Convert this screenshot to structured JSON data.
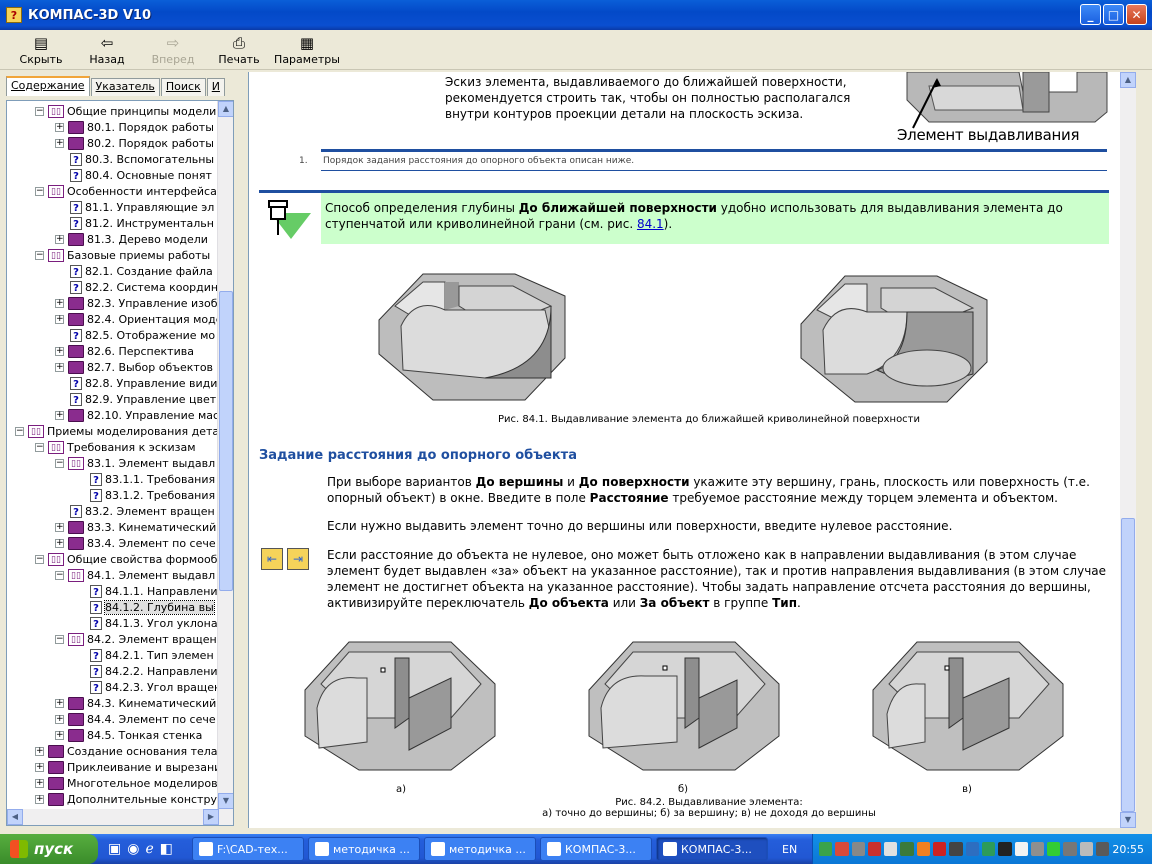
{
  "window": {
    "title": "КОМПАС-3D V10"
  },
  "toolbar": {
    "hide": "Скрыть",
    "back": "Назад",
    "forward": "Вперед",
    "print": "Печать",
    "options": "Параметры"
  },
  "tabs": [
    "Содержание",
    "Указатель",
    "Поиск",
    "И"
  ],
  "tree": [
    {
      "label": "Общие принципы моделир",
      "level": 1,
      "icon": "open",
      "pm": "−"
    },
    {
      "label": "80.1. Порядок работы п",
      "level": 2,
      "icon": "book",
      "pm": "+"
    },
    {
      "label": "80.2. Порядок работы п",
      "level": 2,
      "icon": "book",
      "pm": "+"
    },
    {
      "label": "80.3. Вспомогательны",
      "level": 2,
      "icon": "page",
      "pm": ""
    },
    {
      "label": "80.4. Основные понят",
      "level": 2,
      "icon": "page",
      "pm": ""
    },
    {
      "label": "Особенности интерфейса",
      "level": 1,
      "icon": "open",
      "pm": "−"
    },
    {
      "label": "81.1. Управляющие эл",
      "level": 2,
      "icon": "page",
      "pm": ""
    },
    {
      "label": "81.2. Инструментальн",
      "level": 2,
      "icon": "page",
      "pm": ""
    },
    {
      "label": "81.3. Дерево модели",
      "level": 2,
      "icon": "book",
      "pm": "+"
    },
    {
      "label": "Базовые приемы работы",
      "level": 1,
      "icon": "open",
      "pm": "−"
    },
    {
      "label": "82.1. Создание файла",
      "level": 2,
      "icon": "page",
      "pm": ""
    },
    {
      "label": "82.2. Система координ",
      "level": 2,
      "icon": "page",
      "pm": ""
    },
    {
      "label": "82.3. Управление изоб",
      "level": 2,
      "icon": "book",
      "pm": "+"
    },
    {
      "label": "82.4. Ориентация моде",
      "level": 2,
      "icon": "book",
      "pm": "+"
    },
    {
      "label": "82.5. Отображение мо",
      "level": 2,
      "icon": "page",
      "pm": ""
    },
    {
      "label": "82.6. Перспектива",
      "level": 2,
      "icon": "book",
      "pm": "+"
    },
    {
      "label": "82.7. Выбор объектов",
      "level": 2,
      "icon": "book",
      "pm": "+"
    },
    {
      "label": "82.8. Управление види",
      "level": 2,
      "icon": "page",
      "pm": ""
    },
    {
      "label": "82.9. Управление цвет",
      "level": 2,
      "icon": "page",
      "pm": ""
    },
    {
      "label": "82.10. Управление мас",
      "level": 2,
      "icon": "book",
      "pm": "+"
    },
    {
      "label": "Приемы моделирования дета",
      "level": 0,
      "icon": "open",
      "pm": "−"
    },
    {
      "label": "Требования к эскизам",
      "level": 1,
      "icon": "open",
      "pm": "−"
    },
    {
      "label": "83.1. Элемент выдавл",
      "level": 2,
      "icon": "open",
      "pm": "−"
    },
    {
      "label": "83.1.1. Требования",
      "level": 3,
      "icon": "page",
      "pm": ""
    },
    {
      "label": "83.1.2. Требования",
      "level": 3,
      "icon": "page",
      "pm": ""
    },
    {
      "label": "83.2. Элемент вращен",
      "level": 2,
      "icon": "page",
      "pm": ""
    },
    {
      "label": "83.3. Кинематический",
      "level": 2,
      "icon": "book",
      "pm": "+"
    },
    {
      "label": "83.4. Элемент по сече",
      "level": 2,
      "icon": "book",
      "pm": "+"
    },
    {
      "label": "Общие свойства формооб",
      "level": 1,
      "icon": "open",
      "pm": "−"
    },
    {
      "label": "84.1. Элемент выдавл",
      "level": 2,
      "icon": "open",
      "pm": "−"
    },
    {
      "label": "84.1.1. Направлени",
      "level": 3,
      "icon": "page",
      "pm": ""
    },
    {
      "label": "84.1.2. Глубина вы",
      "level": 3,
      "icon": "page",
      "pm": "",
      "selected": true
    },
    {
      "label": "84.1.3. Угол уклона",
      "level": 3,
      "icon": "page",
      "pm": ""
    },
    {
      "label": "84.2. Элемент вращен",
      "level": 2,
      "icon": "open",
      "pm": "−"
    },
    {
      "label": "84.2.1. Тип элемен",
      "level": 3,
      "icon": "page",
      "pm": ""
    },
    {
      "label": "84.2.2. Направлени",
      "level": 3,
      "icon": "page",
      "pm": ""
    },
    {
      "label": "84.2.3. Угол вращен",
      "level": 3,
      "icon": "page",
      "pm": ""
    },
    {
      "label": "84.3. Кинематический",
      "level": 2,
      "icon": "book",
      "pm": "+"
    },
    {
      "label": "84.4. Элемент по сече",
      "level": 2,
      "icon": "book",
      "pm": "+"
    },
    {
      "label": "84.5. Тонкая стенка",
      "level": 2,
      "icon": "book",
      "pm": "+"
    },
    {
      "label": "Создание основания тела",
      "level": 1,
      "icon": "book",
      "pm": "+"
    },
    {
      "label": "Приклеивание и вырезани",
      "level": 1,
      "icon": "book",
      "pm": "+"
    },
    {
      "label": "Многотельное моделирова",
      "level": 1,
      "icon": "book",
      "pm": "+"
    },
    {
      "label": "Дополнительные конструк",
      "level": 1,
      "icon": "book",
      "pm": "+"
    }
  ],
  "content": {
    "intro": "Эскиз элемента, выдавливаемого до ближайшей поверхности, рекомендуется строить так, чтобы он полностью располагался внутри контуров проекции детали на плоскость эскиза.",
    "fig_label": "Элемент выдавливания",
    "footnote_num": "1.",
    "footnote": "Порядок задания расстояния до опорного объекта описан ниже.",
    "note_a": "Способ определения глубины ",
    "note_b": "До ближайшей поверхности",
    "note_c": " удобно использовать для выдавливания элемента до ступенчатой или криволинейной грани (см. рис. ",
    "note_link": "84.1",
    "note_d": ").",
    "fig1_caption": "Рис. 84.1. Выдавливание элемента до ближайшей криволинейной поверхности",
    "heading": "Задание расстояния до опорного объекта",
    "p1_a": "При выборе вариантов ",
    "p1_b": "До вершины",
    "p1_c": " и ",
    "p1_d": "До поверхности",
    "p1_e": " укажите эту вершину, грань, плоскость или поверхность (т.е. опорный объект) в окне. Введите в поле ",
    "p1_f": "Расстояние",
    "p1_g": " требуемое расстояние между торцем элемента и объектом.",
    "p2": "Если нужно выдавить элемент точно до вершины или поверхности, введите нулевое расстояние.",
    "p3_a": "Если расстояние до объекта не нулевое, оно может быть отложено как в направлении выдавливания (в этом случае элемент будет выдавлен «за» объект на указанное расстояние), так и против направления выдавливания (в этом случае элемент не достигнет объекта на указанное расстояние). Чтобы задать направление отсчета расстояния до вершины, активизируйте переключатель ",
    "p3_b": "До объекта",
    "p3_c": " или ",
    "p3_d": "За объект",
    "p3_e": " в группе ",
    "p3_f": "Тип",
    "p3_g": ".",
    "sub_a": "а)",
    "sub_b": "б)",
    "sub_c": "в)",
    "fig2_caption_1": "Рис. 84.2. Выдавливание элемента:",
    "fig2_caption_2": "а) точно до вершины; б) за вершину; в) не доходя до вершины"
  },
  "taskbar": {
    "start": "пуск",
    "tasks": [
      "F:\\CAD-тех...",
      "методичка ...",
      "методичка ...",
      "КОМПАС-3...",
      "КОМПАС-3..."
    ],
    "lang": "EN",
    "clock": "20:55"
  },
  "colors": {
    "accent": "#1f4fa0",
    "note_bg": "#ccffcc",
    "title_blue": "#0a5fd8"
  }
}
